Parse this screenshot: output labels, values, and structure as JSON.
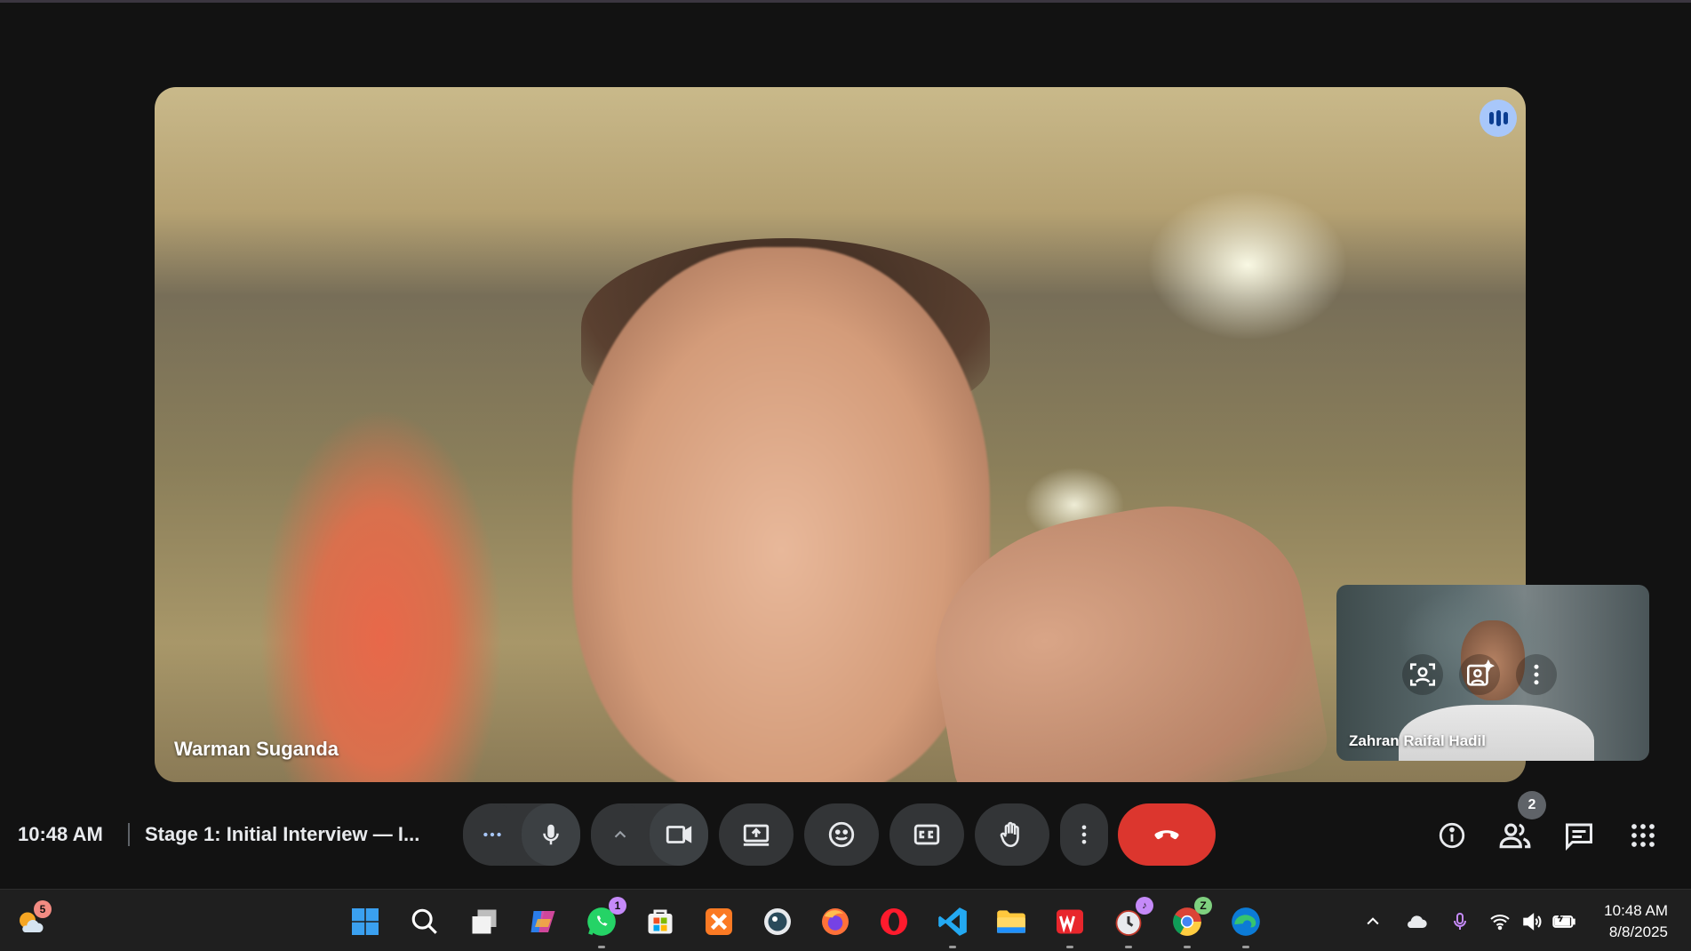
{
  "meeting": {
    "time": "10:48 AM",
    "title": "Stage 1: Initial Interview — I..."
  },
  "main_participant": {
    "name": "Warman Suganda",
    "speaking_icon": "audio-level-icon"
  },
  "self_view": {
    "name": "Zahran Raifal Hadil",
    "controls": [
      "reframe-icon",
      "effects-icon",
      "more-vert-icon"
    ]
  },
  "controls": {
    "audio_options_icon": "more-horiz-icon",
    "mic_icon": "mic-icon",
    "video_options_icon": "chevron-up-icon",
    "camera_icon": "videocam-icon",
    "present_icon": "present-screen-icon",
    "reactions_icon": "emoji-icon",
    "captions_icon": "closed-captions-icon",
    "raise_hand_icon": "hand-icon",
    "more_icon": "more-vert-icon",
    "end_call_icon": "call-end-icon",
    "end_call_color": "#dc362e"
  },
  "side_panel": {
    "info_icon": "info-icon",
    "people_icon": "people-icon",
    "people_count": "2",
    "chat_icon": "chat-icon",
    "activities_icon": "apps-grid-icon"
  },
  "taskbar": {
    "weather_badge": "5",
    "apps": [
      {
        "name": "start",
        "icon": "windows-icon"
      },
      {
        "name": "search",
        "icon": "search-icon"
      },
      {
        "name": "task-view",
        "icon": "task-view-icon"
      },
      {
        "name": "copilot",
        "icon": "copilot-icon"
      },
      {
        "name": "whatsapp",
        "icon": "whatsapp-icon",
        "badge": "1"
      },
      {
        "name": "store",
        "icon": "store-icon"
      },
      {
        "name": "xampp",
        "icon": "xampp-icon"
      },
      {
        "name": "agent",
        "icon": "agent-icon"
      },
      {
        "name": "firefox",
        "icon": "firefox-icon"
      },
      {
        "name": "opera",
        "icon": "opera-icon"
      },
      {
        "name": "vscode",
        "icon": "vscode-icon"
      },
      {
        "name": "file-explorer",
        "icon": "folder-icon"
      },
      {
        "name": "wps",
        "icon": "wps-icon"
      },
      {
        "name": "clock",
        "icon": "clock-icon"
      },
      {
        "name": "chrome",
        "icon": "chrome-icon",
        "badge": "Z"
      },
      {
        "name": "edge",
        "icon": "edge-icon"
      }
    ],
    "time": "10:48 AM",
    "date": "8/8/2025"
  }
}
